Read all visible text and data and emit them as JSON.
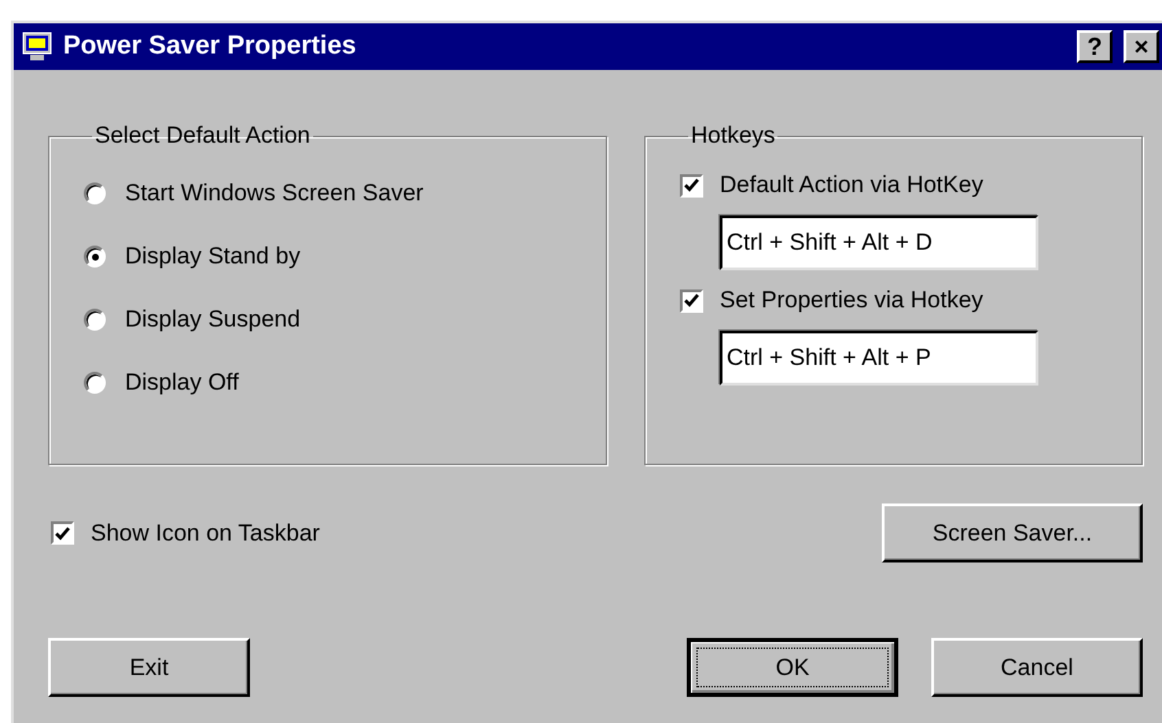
{
  "window": {
    "title": "Power Saver Properties",
    "buttons": [
      {
        "label": "?"
      },
      {
        "label": "×"
      }
    ]
  },
  "default_action": {
    "title": "Select Default Action",
    "options": [
      {
        "label": "Start Windows Screen Saver",
        "selected": false
      },
      {
        "label": "Display Stand by",
        "selected": true
      },
      {
        "label": "Display Suspend",
        "selected": false
      },
      {
        "label": "Display Off",
        "selected": false
      }
    ]
  },
  "hotkeys": {
    "title": "Hotkeys",
    "items": [
      {
        "label": "Default Action via HotKey",
        "checked": true,
        "value": "Ctrl + Shift + Alt + D"
      },
      {
        "label": "Set Properties via Hotkey",
        "checked": true,
        "value": "Ctrl + Shift + Alt + P"
      }
    ]
  },
  "show_icon": {
    "label": "Show Icon on Taskbar",
    "checked": true
  },
  "screen_saver_button": {
    "label": "Screen Saver...",
    "focused": false
  },
  "buttons": [
    {
      "label": "Exit",
      "focused": false
    },
    {
      "label": "OK",
      "focused": true
    },
    {
      "label": "Cancel",
      "focused": false
    }
  ]
}
